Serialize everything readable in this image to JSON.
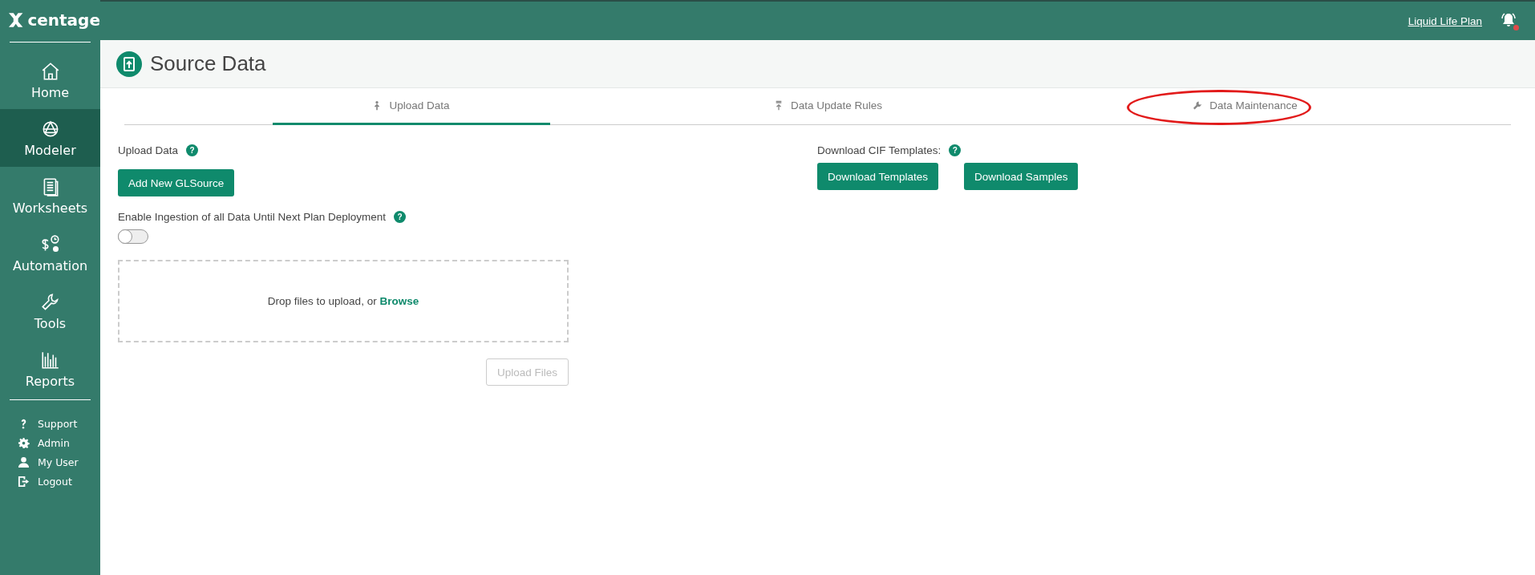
{
  "brand": {
    "name": "centage"
  },
  "top_bar": {
    "plan_link": "Liquid Life Plan",
    "notification_dot": true
  },
  "sidebar": {
    "items": [
      {
        "label": "Home",
        "selected": false
      },
      {
        "label": "Modeler",
        "selected": true
      },
      {
        "label": "Worksheets",
        "selected": false
      },
      {
        "label": "Automation",
        "selected": false
      },
      {
        "label": "Tools",
        "selected": false
      },
      {
        "label": "Reports",
        "selected": false
      }
    ],
    "footer_items": [
      {
        "label": "Support"
      },
      {
        "label": "Admin"
      },
      {
        "label": "My User"
      },
      {
        "label": "Logout"
      }
    ]
  },
  "page": {
    "title": "Source Data"
  },
  "tabs": [
    {
      "label": "Upload Data",
      "selected": true,
      "highlighted": false
    },
    {
      "label": "Data Update Rules",
      "selected": false,
      "highlighted": false
    },
    {
      "label": "Data Maintenance",
      "selected": false,
      "highlighted": true
    }
  ],
  "upload": {
    "heading": "Upload Data",
    "heading_help": "?",
    "add_button": "Add New GLSource",
    "ingestion_label": "Enable Ingestion of all Data Until Next Plan Deployment",
    "ingestion_help": "?",
    "ingestion_on": false,
    "drop_text": "Drop files to upload, or **Browse**",
    "upload_button": "Upload Files",
    "upload_disabled": true
  },
  "templates": {
    "heading": "Download CIF Templates:",
    "heading_help": "?",
    "buttons": [
      "Download Templates",
      "Download Samples"
    ]
  }
}
